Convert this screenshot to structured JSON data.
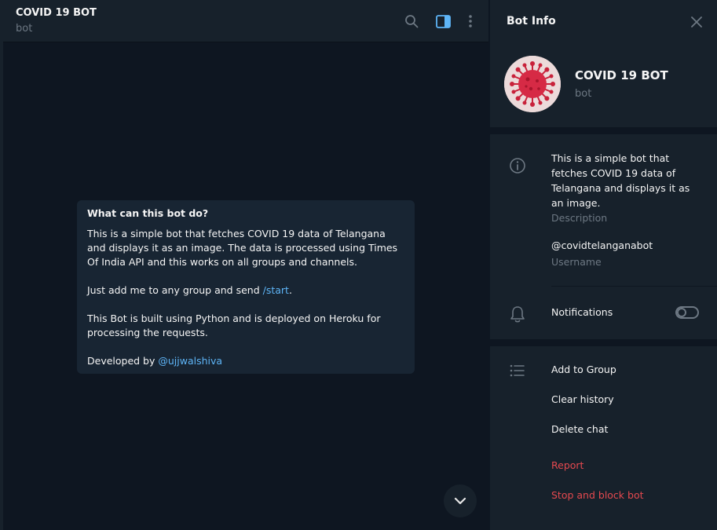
{
  "chat": {
    "title": "COVID 19 BOT",
    "subtitle": "bot"
  },
  "intro": {
    "title": "What can this bot do?",
    "p1": "This is a simple bot that fetches COVID 19 data of Telangana and displays it as an image. The data is processed using Times Of India API and this works on all groups and channels.",
    "p2_before": "Just add me to any group and send ",
    "p2_link": "/start",
    "p2_after": ".",
    "p3": "This Bot is built using Python and is deployed on Heroku for processing the requests.",
    "p4_before": "Developed by ",
    "p4_link": "@ujjwalshiva"
  },
  "panel": {
    "title": "Bot Info",
    "name": "COVID 19 BOT",
    "subtitle": "bot",
    "description": "This is a simple bot that fetches COVID 19 data of Telangana and displays it as an image.",
    "description_label": "Description",
    "username": "@covidtelanganabot",
    "username_label": "Username",
    "notifications_label": "Notifications",
    "notifications_on": false,
    "actions": {
      "add_to_group": "Add to Group",
      "clear_history": "Clear history",
      "delete_chat": "Delete chat",
      "report": "Report",
      "stop_block": "Stop and block bot"
    }
  },
  "colors": {
    "background": "#0e1621",
    "panel": "#17212b",
    "bubble": "#182533",
    "link": "#5eb5f7",
    "danger": "#e5494f",
    "muted": "#6d7883"
  },
  "icons": [
    "search-icon",
    "sidebar-toggle-icon",
    "more-vertical-icon",
    "close-icon",
    "info-icon",
    "bell-icon",
    "list-icon",
    "chevron-down-icon",
    "virus-avatar"
  ]
}
